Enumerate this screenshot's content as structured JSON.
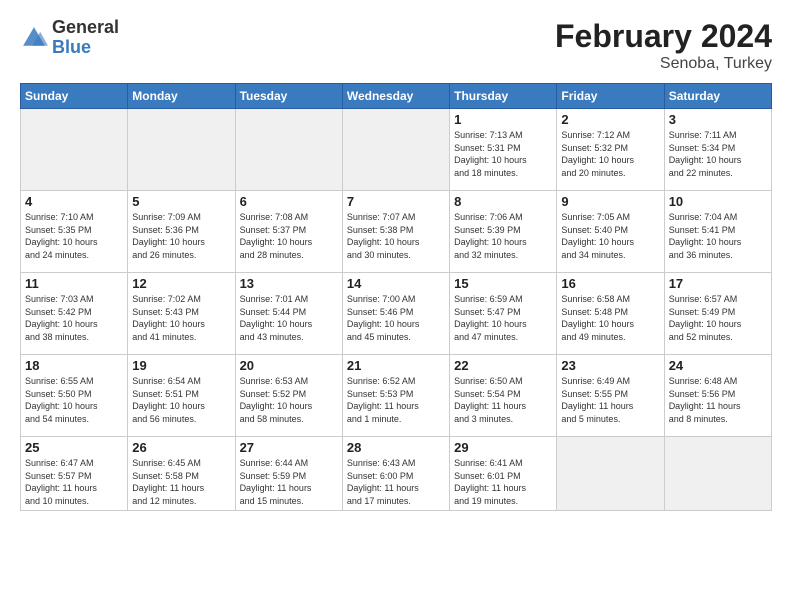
{
  "header": {
    "logo_general": "General",
    "logo_blue": "Blue",
    "title": "February 2024",
    "subtitle": "Senoba, Turkey"
  },
  "days_of_week": [
    "Sunday",
    "Monday",
    "Tuesday",
    "Wednesday",
    "Thursday",
    "Friday",
    "Saturday"
  ],
  "weeks": [
    [
      {
        "day": "",
        "empty": true
      },
      {
        "day": "",
        "empty": true
      },
      {
        "day": "",
        "empty": true
      },
      {
        "day": "",
        "empty": true
      },
      {
        "day": "1",
        "info": "Sunrise: 7:13 AM\nSunset: 5:31 PM\nDaylight: 10 hours\nand 18 minutes."
      },
      {
        "day": "2",
        "info": "Sunrise: 7:12 AM\nSunset: 5:32 PM\nDaylight: 10 hours\nand 20 minutes."
      },
      {
        "day": "3",
        "info": "Sunrise: 7:11 AM\nSunset: 5:34 PM\nDaylight: 10 hours\nand 22 minutes."
      }
    ],
    [
      {
        "day": "4",
        "info": "Sunrise: 7:10 AM\nSunset: 5:35 PM\nDaylight: 10 hours\nand 24 minutes."
      },
      {
        "day": "5",
        "info": "Sunrise: 7:09 AM\nSunset: 5:36 PM\nDaylight: 10 hours\nand 26 minutes."
      },
      {
        "day": "6",
        "info": "Sunrise: 7:08 AM\nSunset: 5:37 PM\nDaylight: 10 hours\nand 28 minutes."
      },
      {
        "day": "7",
        "info": "Sunrise: 7:07 AM\nSunset: 5:38 PM\nDaylight: 10 hours\nand 30 minutes."
      },
      {
        "day": "8",
        "info": "Sunrise: 7:06 AM\nSunset: 5:39 PM\nDaylight: 10 hours\nand 32 minutes."
      },
      {
        "day": "9",
        "info": "Sunrise: 7:05 AM\nSunset: 5:40 PM\nDaylight: 10 hours\nand 34 minutes."
      },
      {
        "day": "10",
        "info": "Sunrise: 7:04 AM\nSunset: 5:41 PM\nDaylight: 10 hours\nand 36 minutes."
      }
    ],
    [
      {
        "day": "11",
        "info": "Sunrise: 7:03 AM\nSunset: 5:42 PM\nDaylight: 10 hours\nand 38 minutes."
      },
      {
        "day": "12",
        "info": "Sunrise: 7:02 AM\nSunset: 5:43 PM\nDaylight: 10 hours\nand 41 minutes."
      },
      {
        "day": "13",
        "info": "Sunrise: 7:01 AM\nSunset: 5:44 PM\nDaylight: 10 hours\nand 43 minutes."
      },
      {
        "day": "14",
        "info": "Sunrise: 7:00 AM\nSunset: 5:46 PM\nDaylight: 10 hours\nand 45 minutes."
      },
      {
        "day": "15",
        "info": "Sunrise: 6:59 AM\nSunset: 5:47 PM\nDaylight: 10 hours\nand 47 minutes."
      },
      {
        "day": "16",
        "info": "Sunrise: 6:58 AM\nSunset: 5:48 PM\nDaylight: 10 hours\nand 49 minutes."
      },
      {
        "day": "17",
        "info": "Sunrise: 6:57 AM\nSunset: 5:49 PM\nDaylight: 10 hours\nand 52 minutes."
      }
    ],
    [
      {
        "day": "18",
        "info": "Sunrise: 6:55 AM\nSunset: 5:50 PM\nDaylight: 10 hours\nand 54 minutes."
      },
      {
        "day": "19",
        "info": "Sunrise: 6:54 AM\nSunset: 5:51 PM\nDaylight: 10 hours\nand 56 minutes."
      },
      {
        "day": "20",
        "info": "Sunrise: 6:53 AM\nSunset: 5:52 PM\nDaylight: 10 hours\nand 58 minutes."
      },
      {
        "day": "21",
        "info": "Sunrise: 6:52 AM\nSunset: 5:53 PM\nDaylight: 11 hours\nand 1 minute."
      },
      {
        "day": "22",
        "info": "Sunrise: 6:50 AM\nSunset: 5:54 PM\nDaylight: 11 hours\nand 3 minutes."
      },
      {
        "day": "23",
        "info": "Sunrise: 6:49 AM\nSunset: 5:55 PM\nDaylight: 11 hours\nand 5 minutes."
      },
      {
        "day": "24",
        "info": "Sunrise: 6:48 AM\nSunset: 5:56 PM\nDaylight: 11 hours\nand 8 minutes."
      }
    ],
    [
      {
        "day": "25",
        "info": "Sunrise: 6:47 AM\nSunset: 5:57 PM\nDaylight: 11 hours\nand 10 minutes."
      },
      {
        "day": "26",
        "info": "Sunrise: 6:45 AM\nSunset: 5:58 PM\nDaylight: 11 hours\nand 12 minutes."
      },
      {
        "day": "27",
        "info": "Sunrise: 6:44 AM\nSunset: 5:59 PM\nDaylight: 11 hours\nand 15 minutes."
      },
      {
        "day": "28",
        "info": "Sunrise: 6:43 AM\nSunset: 6:00 PM\nDaylight: 11 hours\nand 17 minutes."
      },
      {
        "day": "29",
        "info": "Sunrise: 6:41 AM\nSunset: 6:01 PM\nDaylight: 11 hours\nand 19 minutes."
      },
      {
        "day": "",
        "empty": true
      },
      {
        "day": "",
        "empty": true
      }
    ]
  ]
}
